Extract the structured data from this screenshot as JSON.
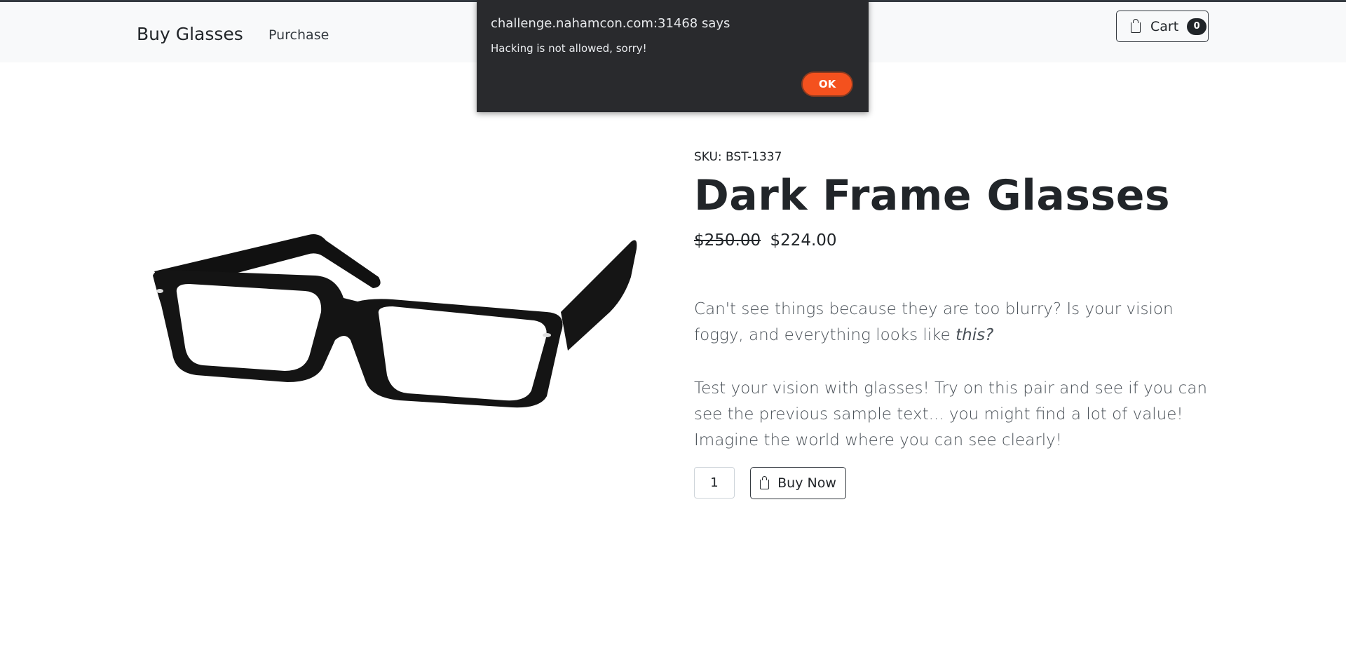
{
  "navbar": {
    "brand": "Buy Glasses",
    "links": [
      "Purchase"
    ],
    "cart_label": "Cart",
    "cart_count": "0"
  },
  "product": {
    "sku": "SKU: BST-1337",
    "title": "Dark Frame Glasses",
    "old_price": "$250.00",
    "price": "$224.00",
    "description_1": "Can't see things because they are too blurry? Is your vision foggy, and everything looks like",
    "description_1_italic": "this?",
    "description_2": "Test your vision with glasses! Try on this pair and see if you can see the previous sample text... you might find a lot of value! Imagine the world where you can see clearly!",
    "quantity": "1",
    "buy_label": "Buy Now"
  },
  "dialog": {
    "origin": "challenge.nahamcon.com:31468 says",
    "message": "Hacking is not allowed, sorry!",
    "ok_label": "OK",
    "ok_color": "#f4511e"
  }
}
